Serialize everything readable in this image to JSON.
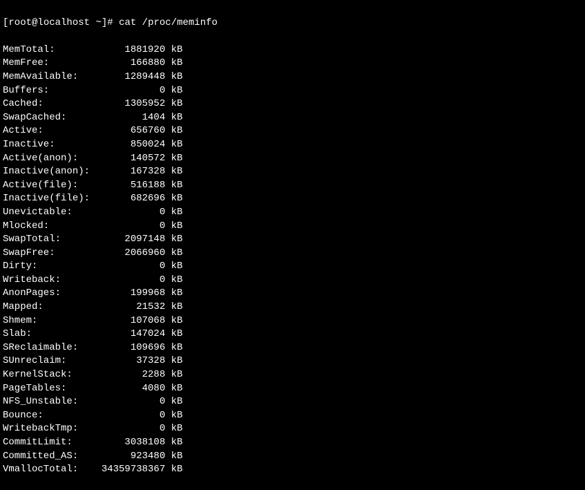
{
  "prompt": {
    "user": "root",
    "host": "localhost",
    "path": "~",
    "symbol": "#"
  },
  "command": "cat /proc/meminfo",
  "meminfo": [
    {
      "label": "MemTotal:",
      "value": "1881920",
      "unit": "kB"
    },
    {
      "label": "MemFree:",
      "value": "166880",
      "unit": "kB"
    },
    {
      "label": "MemAvailable:",
      "value": "1289448",
      "unit": "kB"
    },
    {
      "label": "Buffers:",
      "value": "0",
      "unit": "kB"
    },
    {
      "label": "Cached:",
      "value": "1305952",
      "unit": "kB"
    },
    {
      "label": "SwapCached:",
      "value": "1404",
      "unit": "kB"
    },
    {
      "label": "Active:",
      "value": "656760",
      "unit": "kB"
    },
    {
      "label": "Inactive:",
      "value": "850024",
      "unit": "kB"
    },
    {
      "label": "Active(anon):",
      "value": "140572",
      "unit": "kB"
    },
    {
      "label": "Inactive(anon):",
      "value": "167328",
      "unit": "kB"
    },
    {
      "label": "Active(file):",
      "value": "516188",
      "unit": "kB"
    },
    {
      "label": "Inactive(file):",
      "value": "682696",
      "unit": "kB"
    },
    {
      "label": "Unevictable:",
      "value": "0",
      "unit": "kB"
    },
    {
      "label": "Mlocked:",
      "value": "0",
      "unit": "kB"
    },
    {
      "label": "SwapTotal:",
      "value": "2097148",
      "unit": "kB"
    },
    {
      "label": "SwapFree:",
      "value": "2066960",
      "unit": "kB"
    },
    {
      "label": "Dirty:",
      "value": "0",
      "unit": "kB"
    },
    {
      "label": "Writeback:",
      "value": "0",
      "unit": "kB"
    },
    {
      "label": "AnonPages:",
      "value": "199968",
      "unit": "kB"
    },
    {
      "label": "Mapped:",
      "value": "21532",
      "unit": "kB"
    },
    {
      "label": "Shmem:",
      "value": "107068",
      "unit": "kB"
    },
    {
      "label": "Slab:",
      "value": "147024",
      "unit": "kB"
    },
    {
      "label": "SReclaimable:",
      "value": "109696",
      "unit": "kB"
    },
    {
      "label": "SUnreclaim:",
      "value": "37328",
      "unit": "kB"
    },
    {
      "label": "KernelStack:",
      "value": "2288",
      "unit": "kB"
    },
    {
      "label": "PageTables:",
      "value": "4080",
      "unit": "kB"
    },
    {
      "label": "NFS_Unstable:",
      "value": "0",
      "unit": "kB"
    },
    {
      "label": "Bounce:",
      "value": "0",
      "unit": "kB"
    },
    {
      "label": "WritebackTmp:",
      "value": "0",
      "unit": "kB"
    },
    {
      "label": "CommitLimit:",
      "value": "3038108",
      "unit": "kB"
    },
    {
      "label": "Committed_AS:",
      "value": "923480",
      "unit": "kB"
    },
    {
      "label": "VmallocTotal:",
      "value": "34359738367",
      "unit": "kB"
    }
  ]
}
